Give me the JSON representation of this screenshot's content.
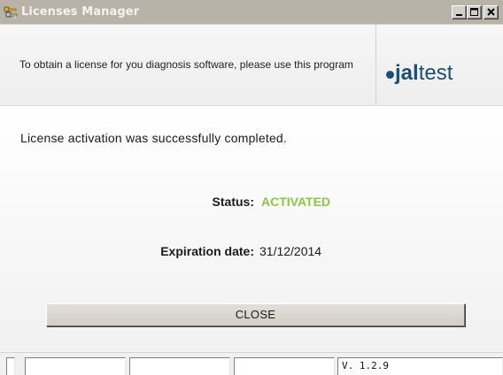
{
  "window": {
    "title": "Licenses Manager",
    "icon": "keys-icon",
    "controls": [
      "minimize",
      "maximize",
      "close"
    ]
  },
  "header": {
    "description": "To obtain a license for you diagnosis software, please use this program",
    "logo_bold": "jal",
    "logo_light": "test"
  },
  "main": {
    "message": "License activation was successfully completed.",
    "status_label": "Status:",
    "status_value": "ACTIVATED",
    "expiration_label": "Expiration date:",
    "expiration_value": "31/12/2014",
    "close_label": "CLOSE"
  },
  "statusbar": {
    "version": "V. 1.2.9"
  },
  "colors": {
    "titlebar": "#b7b3a8",
    "status_active": "#8dc63f",
    "logo": "#1c4e78",
    "button_face": "#d4d0c8"
  }
}
